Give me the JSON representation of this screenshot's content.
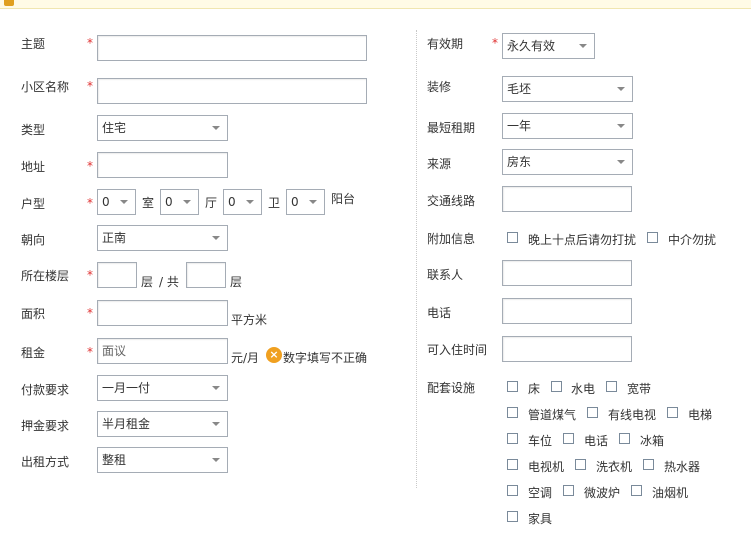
{
  "left": {
    "subject": {
      "label": "主题"
    },
    "community": {
      "label": "小区名称"
    },
    "type": {
      "label": "类型",
      "value": "住宅"
    },
    "address": {
      "label": "地址"
    },
    "layout": {
      "label": "户型",
      "room": "0",
      "room_unit": "室",
      "hall": "0",
      "hall_unit": "厅",
      "bath": "0",
      "bath_unit": "卫",
      "balcony": "0",
      "balcony_unit": "阳台"
    },
    "orientation": {
      "label": "朝向",
      "value": "正南"
    },
    "floor": {
      "label": "所在楼层",
      "unit1": "层",
      "sep": "/ 共",
      "unit2": "层"
    },
    "area": {
      "label": "面积",
      "unit": "平方米"
    },
    "rent": {
      "label": "租金",
      "placeholder": "面议",
      "unit": "元/月",
      "error": "数字填写不正确"
    },
    "payment": {
      "label": "付款要求",
      "value": "一月一付"
    },
    "deposit": {
      "label": "押金要求",
      "value": "半月租金"
    },
    "rental_mode": {
      "label": "出租方式",
      "value": "整租"
    }
  },
  "right": {
    "validity": {
      "label": "有效期",
      "value": "永久有效"
    },
    "decoration": {
      "label": "装修",
      "value": "毛坯"
    },
    "min_term": {
      "label": "最短租期",
      "value": "一年"
    },
    "source": {
      "label": "来源",
      "value": "房东"
    },
    "transport": {
      "label": "交通线路"
    },
    "extra": {
      "label": "附加信息",
      "opt1": "晚上十点后请勿打扰",
      "opt2": "中介勿扰"
    },
    "contact": {
      "label": "联系人"
    },
    "phone": {
      "label": "电话"
    },
    "movein": {
      "label": "可入住时间"
    },
    "facilities": {
      "label": "配套设施",
      "items": [
        "床",
        "水电",
        "宽带",
        "管道煤气",
        "有线电视",
        "电梯",
        "车位",
        "电话",
        "冰箱",
        "电视机",
        "洗衣机",
        "热水器",
        "空调",
        "微波炉",
        "油烟机",
        "家具"
      ]
    }
  },
  "required_mark": "*",
  "icons": {
    "warn": "warning-icon",
    "lock": "lock-icon"
  }
}
